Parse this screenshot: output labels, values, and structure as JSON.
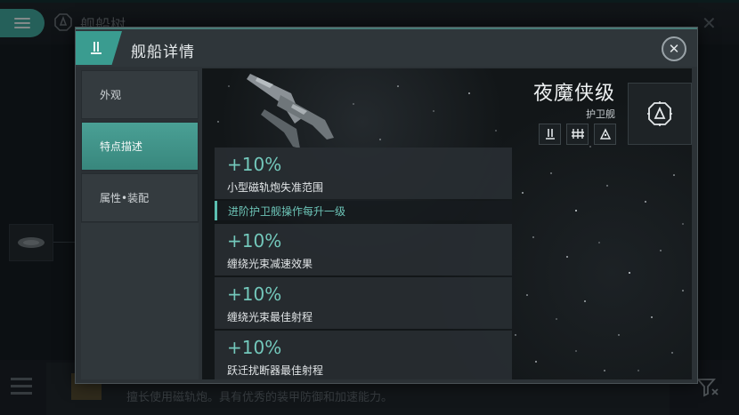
{
  "background": {
    "title": "舰船树",
    "description": "擅长使用磁轨炮。具有优秀的装甲防御和加速能力。"
  },
  "dialog": {
    "title": "舰船详情",
    "close_label": "✕",
    "tabs": [
      {
        "label": "外观",
        "active": false
      },
      {
        "label": "特点描述",
        "active": true
      },
      {
        "label": "属性•装配",
        "active": false
      }
    ],
    "ship": {
      "name": "夜魔侠级",
      "class": "护卫舰"
    },
    "traits": [
      {
        "percent": "+10%",
        "description": "小型磁轨炮失准范围"
      }
    ],
    "trait_section_heading": "进阶护卫舰操作每升一级",
    "section_traits": [
      {
        "percent": "+10%",
        "description": "缠绕光束减速效果"
      },
      {
        "percent": "+10%",
        "description": "缠绕光束最佳射程"
      },
      {
        "percent": "+10%",
        "description": "跃迁扰断器最佳射程"
      }
    ]
  },
  "colors": {
    "accent": "#3fa89b",
    "trait_value": "#73c8bb"
  }
}
